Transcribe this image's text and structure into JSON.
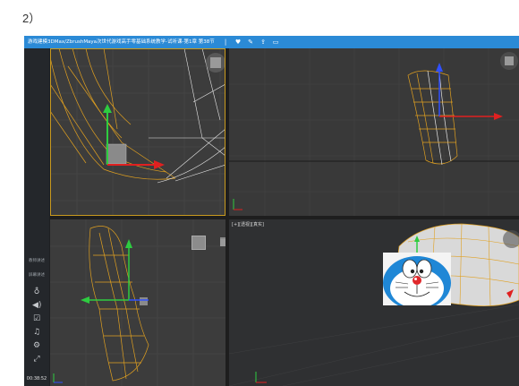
{
  "step_label": "2）",
  "player": {
    "title": "游戏建模3DMax/ZbrushMaya次世代游戏高手零基础系统教学-试听课-第1章 第38节",
    "title_icons": [
      "divider-icon",
      "heart-icon",
      "edit-icon",
      "share-icon",
      "screen-icon"
    ]
  },
  "sidebar": {
    "item1": "教师讲述",
    "item2": "屏幕讲述",
    "icons": [
      "mic-icon",
      "volume-icon",
      "note-icon",
      "music-icon",
      "settings-icon",
      "fullscreen-icon"
    ],
    "time": "00:38:52"
  },
  "viewport": {
    "perspective_label": "[+][透视][真实]"
  },
  "colors": {
    "titlebar": "#2b8ad6",
    "viewport_bg": "#3c3c3c",
    "wire_orange": "#e0a020",
    "wire_white": "#e8e8e8",
    "axis_green": "#2ecc40",
    "axis_red": "#e02020",
    "axis_blue": "#3050ff"
  }
}
